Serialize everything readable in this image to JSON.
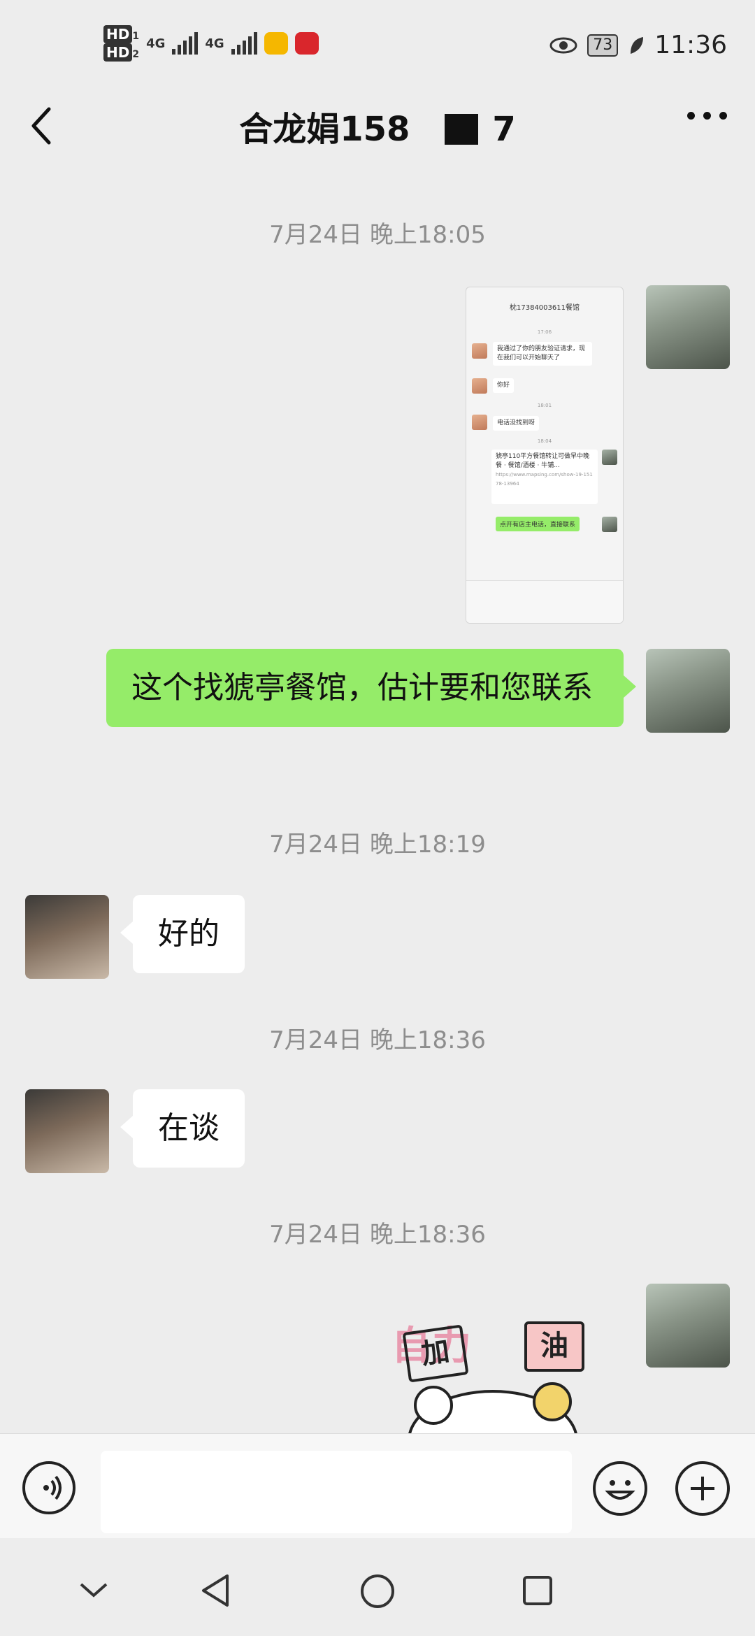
{
  "status_bar": {
    "hd1": "HD",
    "hd2": "HD",
    "sim1_sub": "1",
    "sim2_sub": "2",
    "net1": "4G",
    "net2": "4G",
    "battery": "73",
    "time": "11:36",
    "icons": [
      "mail-app-icon",
      "video-app-icon",
      "eye-icon",
      "leaf-icon"
    ]
  },
  "header": {
    "title_part1": "合龙娟158",
    "title_part2": "7"
  },
  "messages": [
    {
      "type": "timestamp",
      "text": "7月24日 晚上18:05"
    },
    {
      "type": "image",
      "sender": "me"
    },
    {
      "type": "text",
      "sender": "me",
      "text": "这个找猇亭餐馆，估计要和您联系"
    },
    {
      "type": "timestamp",
      "text": "7月24日 晚上18:19"
    },
    {
      "type": "text",
      "sender": "contact",
      "text": "好的"
    },
    {
      "type": "timestamp",
      "text": "7月24日 晚上18:36"
    },
    {
      "type": "text",
      "sender": "contact",
      "text": "在谈"
    },
    {
      "type": "timestamp",
      "text": "7月24日 晚上18:36"
    },
    {
      "type": "sticker",
      "sender": "me"
    }
  ],
  "thumbnail": {
    "title": "枕17384003611餐馆",
    "ts1": "17:06",
    "msg1": "我通过了你的朋友验证请求，现在我们可以开始聊天了",
    "msg2": "你好",
    "ts2": "18:01",
    "msg3": "电话没找到呀",
    "ts3": "18:04",
    "msg4": "猇亭110平方餐馆转让可做早中晚餐 · 餐馆/酒楼 · 牛铺...",
    "msg4_link": "https://www.mapsing.com/show-19-15178-13964",
    "msg5": "点开有店主电话，直接联系"
  },
  "sticker": {
    "word1": "加",
    "word2": "油",
    "bg_text": "自力"
  },
  "colors": {
    "bg": "#ededed",
    "green_bubble": "#95ec69",
    "timestamp": "#8d8d8d"
  }
}
